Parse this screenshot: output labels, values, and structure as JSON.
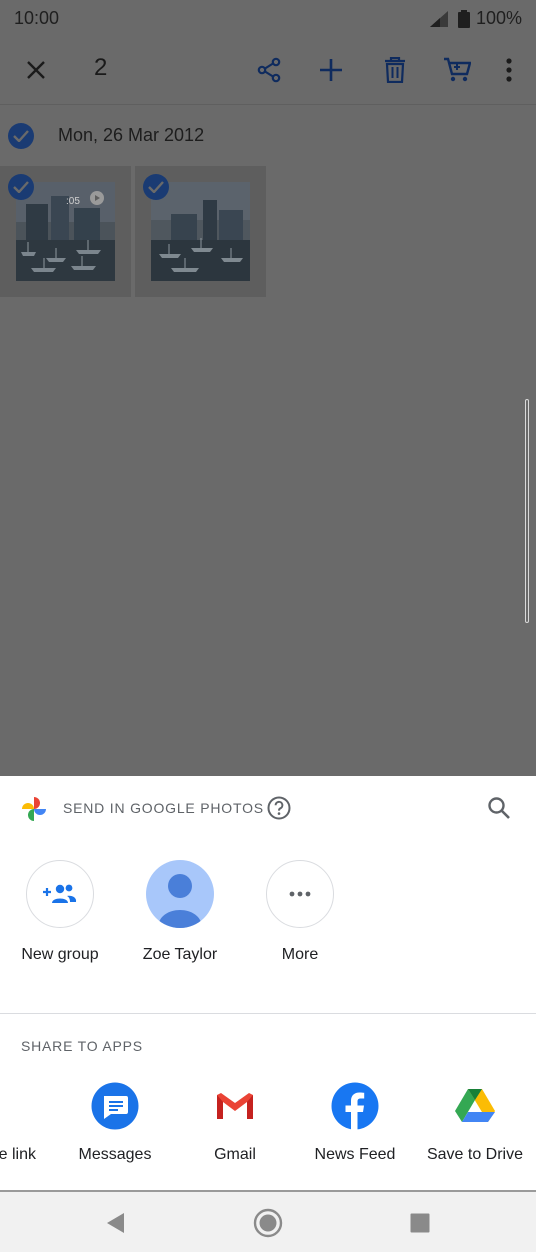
{
  "status": {
    "time": "10:00",
    "battery": "100%"
  },
  "selection": {
    "count": "2"
  },
  "toolbar": {
    "close_icon": "close-icon",
    "share_icon": "share-icon",
    "add_icon": "add-icon",
    "delete_icon": "trash-icon",
    "cart_icon": "cart-icon",
    "more_icon": "more-vert-icon"
  },
  "album": {
    "date": "Mon, 26 Mar 2012",
    "photos": [
      {
        "type": "video",
        "duration": ":05"
      },
      {
        "type": "photo"
      }
    ]
  },
  "sheet": {
    "title": "SEND IN GOOGLE PHOTOS",
    "contacts": [
      {
        "label": "New group",
        "icon": "group-add-icon"
      },
      {
        "label": "Zoe Taylor",
        "icon": "person-icon"
      },
      {
        "label": "More",
        "icon": "more-horiz-icon"
      }
    ],
    "apps_title": "SHARE TO APPS",
    "apps": [
      {
        "label": "e link",
        "icon": "link-icon"
      },
      {
        "label": "Messages",
        "icon": "messages-icon"
      },
      {
        "label": "Gmail",
        "icon": "gmail-icon"
      },
      {
        "label": "News Feed",
        "icon": "facebook-icon"
      },
      {
        "label": "Save to Drive",
        "icon": "drive-icon"
      }
    ]
  },
  "colors": {
    "accent": "#1a73e8",
    "check": "#1a3b73",
    "scrim": "#6a6a6a",
    "avatar_bg": "#a8c7fa",
    "avatar_fg": "#4a7fd9",
    "facebook": "#1877f2",
    "gmail": "#ea4335"
  }
}
